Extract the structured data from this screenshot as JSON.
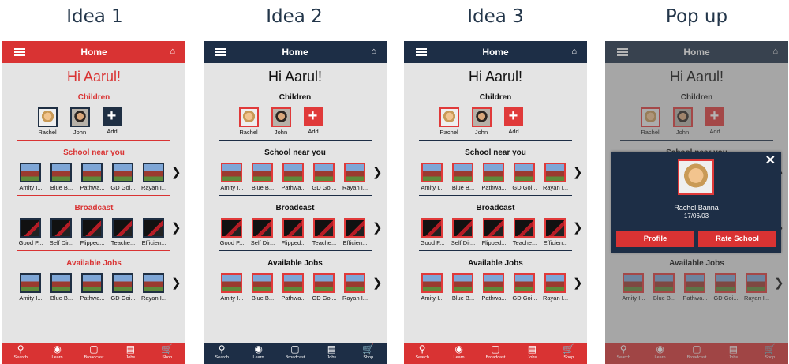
{
  "titles": [
    "Idea 1",
    "Idea 2",
    "Idea 3",
    "Pop up"
  ],
  "app": {
    "header_title": "Home",
    "greeting": "Hi Aarul!",
    "sections": {
      "children": "Children",
      "schools": "School near you",
      "broadcast": "Broadcast",
      "jobs": "Available Jobs"
    },
    "children": [
      "Rachel",
      "John",
      "Add"
    ],
    "schools": [
      "Amity I...",
      "Blue B...",
      "Pathwa...",
      "GD Goi...",
      "Rayan I..."
    ],
    "broadcasts": [
      "Good P...",
      "Self Dir...",
      "Flipped...",
      "Teache...",
      "Efficien..."
    ],
    "jobs": [
      "Amity I...",
      "Blue B...",
      "Pathwa...",
      "GD Goi...",
      "Rayan I..."
    ],
    "tabs": [
      "Search",
      "Learn",
      "Broadcast",
      "Jobs",
      "Shop"
    ]
  },
  "popup": {
    "name": "Rachel Banna",
    "date": "17/06/03",
    "profile_label": "Profile",
    "rate_label": "Rate School"
  },
  "colors": {
    "red": "#d93333",
    "navy": "#1d2e46"
  },
  "icons": [
    "menu-icon",
    "home-icon",
    "chevron-right-icon",
    "close-icon",
    "search-icon",
    "gamepad-icon",
    "tv-icon",
    "briefcase-icon",
    "cart-icon"
  ]
}
